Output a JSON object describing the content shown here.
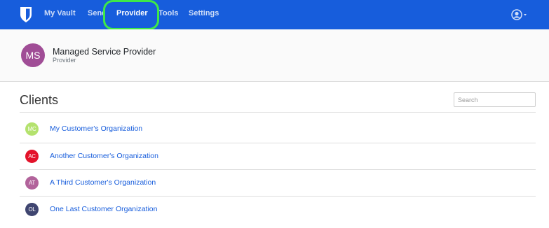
{
  "navbar": {
    "brand_icon": "bitwarden-shield-icon",
    "items": [
      {
        "label": "My Vault"
      },
      {
        "label": "Send"
      },
      {
        "label": "Provider"
      },
      {
        "label": "Tools"
      },
      {
        "label": "Settings"
      }
    ],
    "active_item": "Provider",
    "account_icon": "user-circle-icon",
    "colors": {
      "background": "#175ddc",
      "highlight": "#3ee848"
    }
  },
  "provider": {
    "initials": "MS",
    "name": "Managed Service Provider",
    "role": "Provider",
    "avatar_color": "#a04d96"
  },
  "clients": {
    "title": "Clients",
    "search_placeholder": "Search",
    "items": [
      {
        "initials": "MC",
        "name": "My Customer's Organization",
        "color": "#b4e26e"
      },
      {
        "initials": "AC",
        "name": "Another Customer's Organization",
        "color": "#e3122a"
      },
      {
        "initials": "AT",
        "name": "A Third Customer's Organization",
        "color": "#b2639b"
      },
      {
        "initials": "OL",
        "name": "One Last Customer Organization",
        "color": "#3f4570"
      }
    ]
  }
}
